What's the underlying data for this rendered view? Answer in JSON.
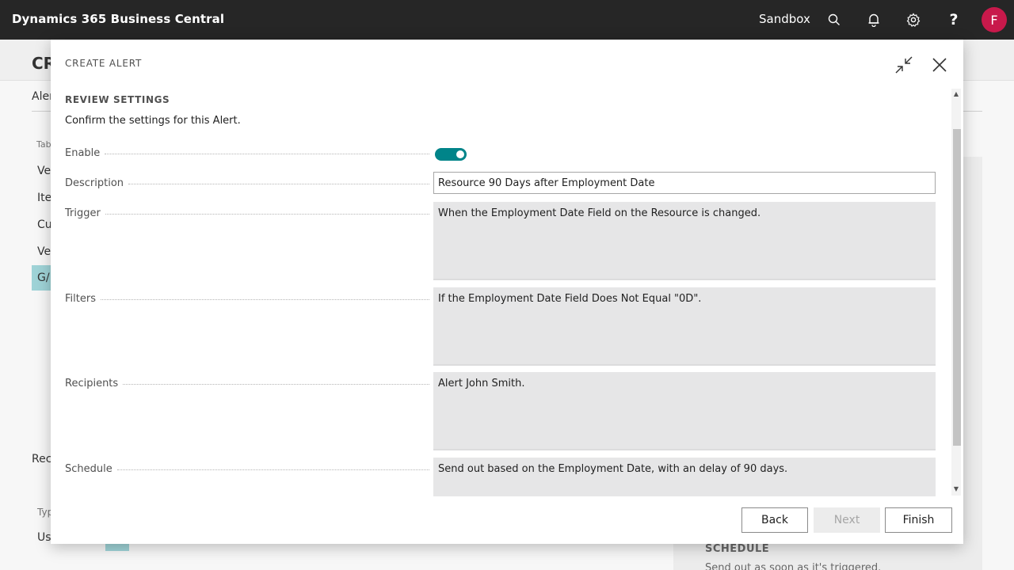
{
  "appbar": {
    "title": "Dynamics 365 Business Central",
    "environment": "Sandbox",
    "avatar_letter": "F",
    "icons": [
      "search-icon",
      "bell-icon",
      "gear-icon",
      "help-icon"
    ]
  },
  "background": {
    "title_fragment": "CR",
    "tab_fragment": "Aler",
    "column_header": "Tab",
    "rows": [
      "Ve",
      "Ite",
      "Cu",
      "Ve",
      "G/"
    ],
    "recipients_fragment": "Reci",
    "type_header": "Typ",
    "row_us": "Us",
    "schedule_title": "SCHEDULE",
    "schedule_text": "Send out as soon as it's triggered."
  },
  "dialog": {
    "title": "CREATE ALERT",
    "section_title": "REVIEW SETTINGS",
    "section_subtitle": "Confirm the settings for this Alert.",
    "fields": {
      "enable": {
        "label": "Enable",
        "value": true
      },
      "description": {
        "label": "Description",
        "value": "Resource 90 Days after Employment Date"
      },
      "trigger": {
        "label": "Trigger",
        "value": "When the Employment Date Field on the Resource is changed."
      },
      "filters": {
        "label": "Filters",
        "value": "If the Employment Date Field Does Not Equal \"0D\"."
      },
      "recipients": {
        "label": "Recipients",
        "value": "Alert John Smith."
      },
      "schedule": {
        "label": "Schedule",
        "value": "Send out based on the Employment Date, with an delay of 90 days."
      }
    },
    "buttons": {
      "back": "Back",
      "next": "Next",
      "finish": "Finish"
    }
  },
  "colors": {
    "appbar": "#262626",
    "accent": "#008489",
    "avatar": "#c8194b",
    "readonly_bg": "#e6e6e7"
  }
}
